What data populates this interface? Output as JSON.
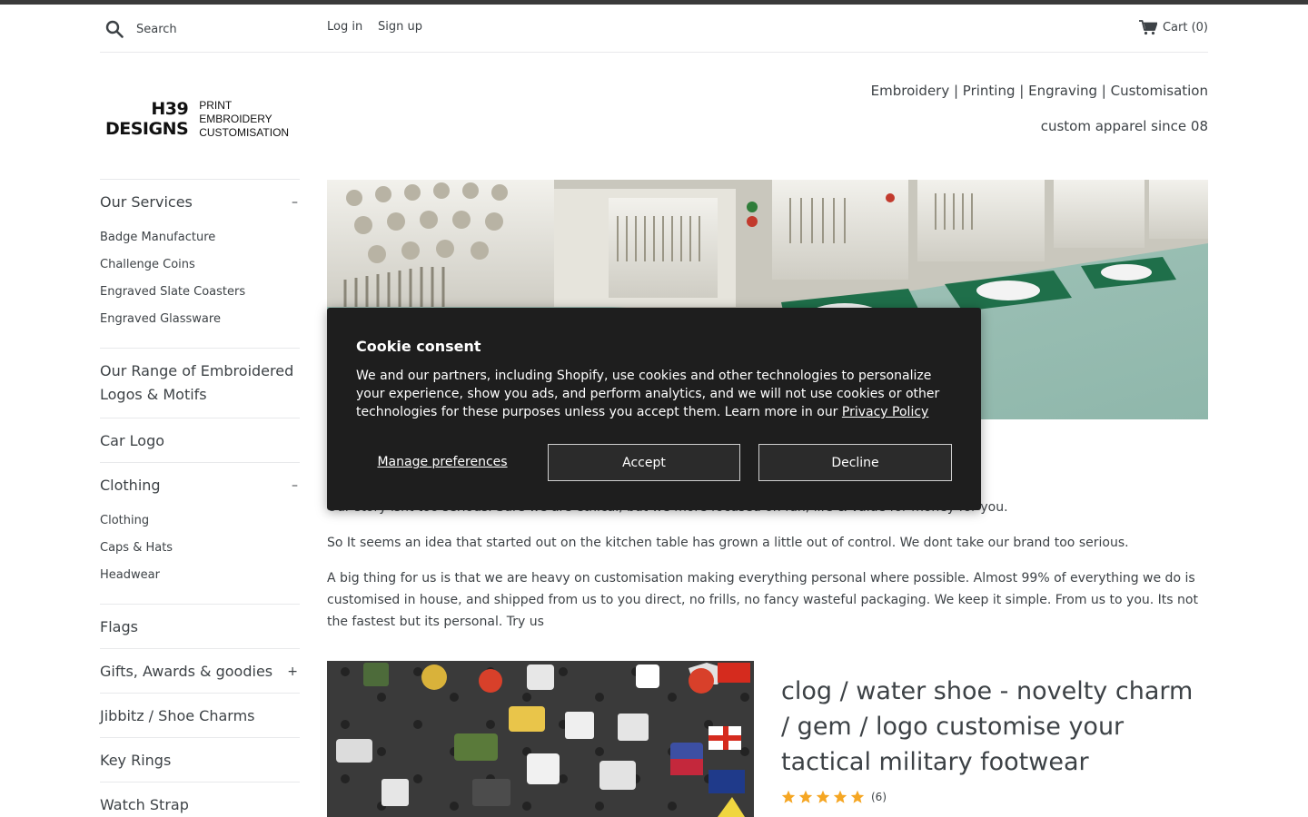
{
  "header": {
    "search_placeholder": "Search",
    "login": "Log in",
    "signup": "Sign up",
    "cart": "Cart (0)"
  },
  "brand": {
    "logo_main_line1": "H39",
    "logo_main_line2": "DESIGNS",
    "logo_sub_line1": "PRINT",
    "logo_sub_line2": "EMBROIDERY",
    "logo_sub_line3": "CUSTOMISATION",
    "tagline_1": "Embroidery | Printing | Engraving | Customisation",
    "tagline_2": "custom apparel since 08"
  },
  "sidebar": {
    "sections": [
      {
        "label": "Our Services",
        "toggle": "–",
        "items": [
          "Badge Manufacture",
          "Challenge Coins",
          "Engraved Slate Coasters",
          "Engraved Glassware"
        ]
      },
      {
        "label": "Our Range of Embroidered Logos & Motifs"
      },
      {
        "label": "Car Logo"
      },
      {
        "label": "Clothing",
        "toggle": "–",
        "items": [
          "Clothing",
          "Caps & Hats",
          "Headwear"
        ]
      },
      {
        "label": "Flags"
      },
      {
        "label": "Gifts, Awards & goodies",
        "toggle": "+"
      },
      {
        "label": "Jibbitz / Shoe Charms"
      },
      {
        "label": "Key Rings"
      },
      {
        "label": "Watch Strap"
      }
    ]
  },
  "content": {
    "para_1": "Our story isnt too serious. Sure we are ethical, but we more focused on fun, life & value for money for you.",
    "para_2": "So It seems an idea that started out on the kitchen table has grown a little out of control.  We dont take our brand too serious.",
    "para_3": "A big thing for us is that we are heavy on customisation making everything personal where possible. Almost 99% of everything we do is customised in house, and shipped from us to you direct, no frills, no fancy wasteful packaging. We keep it simple. From us to you. Its not the fastest but its personal. Try us"
  },
  "product": {
    "title": "clog / water shoe - novelty charm / gem / logo customise your tactical military footwear",
    "rating": 5,
    "review_count": "(6)",
    "star_color": "#f5a623"
  },
  "cookie": {
    "title": "Cookie consent",
    "text": "We and our partners, including Shopify, use cookies and other technologies to personalize your experience, show you ads, and perform analytics, and we will not use cookies or other technologies for these purposes unless you accept them. Learn more in our ",
    "link": "Privacy Policy",
    "manage": "Manage preferences",
    "accept": "Accept",
    "decline": "Decline"
  },
  "icons": {
    "search": "search-icon",
    "cart": "cart-icon",
    "star": "star-icon"
  },
  "colors": {
    "text": "#3d4246",
    "modal_bg": "#1e1e1e",
    "topbar": "#3a3a3a"
  }
}
